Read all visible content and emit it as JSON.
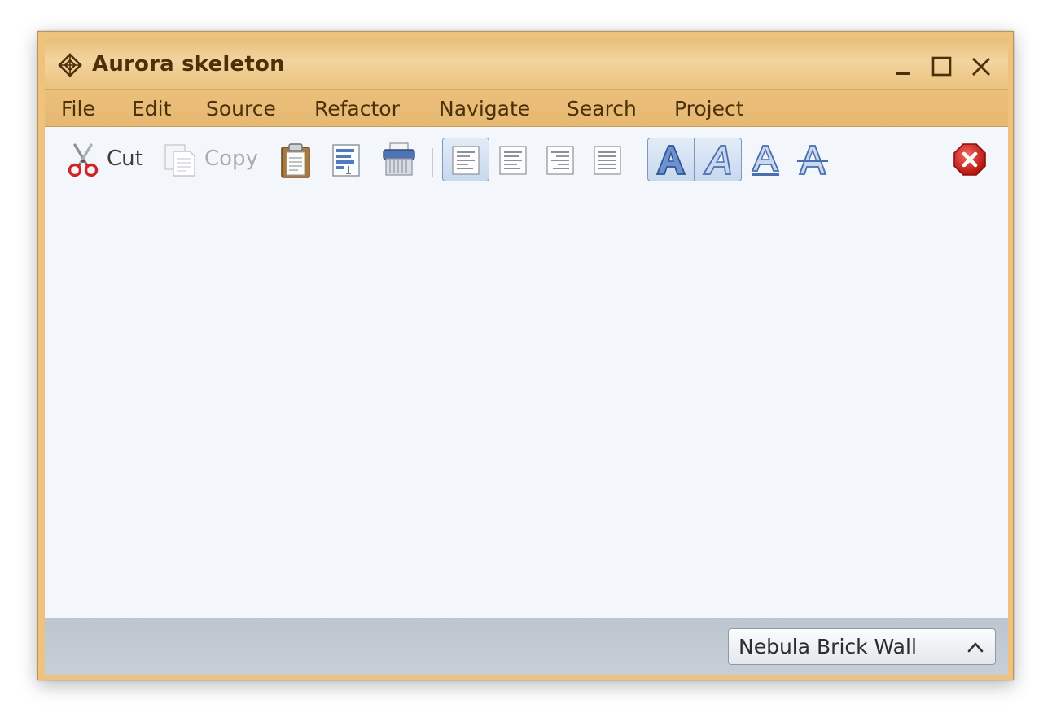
{
  "window": {
    "title": "Aurora skeleton"
  },
  "menu": {
    "items": [
      "File",
      "Edit",
      "Source",
      "Refactor",
      "Navigate",
      "Search",
      "Project"
    ]
  },
  "toolbar": {
    "cut_label": "Cut",
    "copy_label": "Copy"
  },
  "status": {
    "skin_selected": "Nebula Brick Wall"
  },
  "colors": {
    "frame": "#efc27e",
    "title_text": "#4c300a",
    "content_bg": "#f3f6fb",
    "statusbar_bg": "#c2cbd5",
    "toggle_selected": "#c8d8ee"
  }
}
